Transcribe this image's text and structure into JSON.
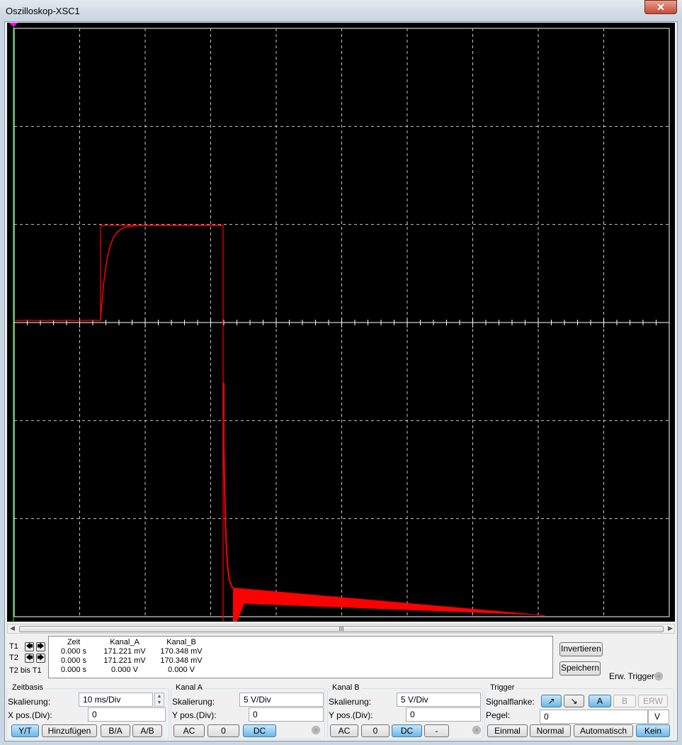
{
  "window": {
    "title": "Oszilloskop-XSC1",
    "close": "✕"
  },
  "scrollbar": {
    "grip": "III",
    "left": "◀",
    "right": "▶"
  },
  "readout": {
    "rows": [
      "T1",
      "T2",
      "T2 bis T1"
    ],
    "headers": [
      "Zeit",
      "Kanal_A",
      "Kanal_B"
    ],
    "values": [
      [
        "0.000 s",
        "171.221 mV",
        "170.348 mV"
      ],
      [
        "0.000 s",
        "171.221 mV",
        "170.348 mV"
      ],
      [
        "0.000 s",
        "0.000 V",
        "0.000 V"
      ]
    ],
    "nav_left": "🡄",
    "nav_right": "🡆"
  },
  "buttons": {
    "invert": "Invertieren",
    "save": "Speichern",
    "ext_trigger": "Erw. Trigger"
  },
  "timebase": {
    "title": "Zeitbasis",
    "scale_label": "Skalierung:",
    "scale": "10 ms/Div",
    "xpos_label": "X pos.(Div):",
    "xpos": "0",
    "modes": [
      "Y/T",
      "Hinzufügen",
      "B/A",
      "A/B"
    ],
    "active": "Y/T"
  },
  "channel_a": {
    "title": "Kanal A",
    "scale_label": "Skalierung:",
    "scale": "5  V/Div",
    "ypos_label": "Y pos.(Div):",
    "ypos": "0",
    "coupling": [
      "AC",
      "0",
      "DC"
    ],
    "active": "DC"
  },
  "channel_b": {
    "title": "Kanal B",
    "scale_label": "Skalierung:",
    "scale": "5  V/Div",
    "ypos_label": "Y pos.(Div):",
    "ypos": "0",
    "coupling": [
      "AC",
      "0",
      "DC",
      "-"
    ],
    "active": "DC"
  },
  "trigger": {
    "title": "Trigger",
    "edge_label": "Signalflanke:",
    "edges": [
      "↗",
      "↘"
    ],
    "sources": [
      "A",
      "B",
      "ERW"
    ],
    "level_label": "Pegel:",
    "level": "0",
    "level_unit": "V",
    "modes": [
      "Einmal",
      "Normal",
      "Automatisch",
      "Kein"
    ],
    "active_mode": "Kein",
    "active_source": "A"
  },
  "colors": {
    "trace": "#ff0000",
    "grid": "#c8c8c8",
    "screen": "#000000"
  }
}
